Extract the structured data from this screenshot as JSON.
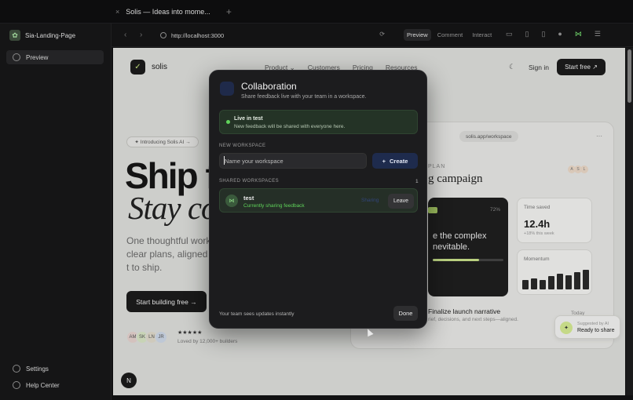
{
  "window": {
    "tab_title": "Solis — Ideas into mome...",
    "tab_close": "×",
    "new_tab": "+"
  },
  "sidebar": {
    "project": "Sia-Landing-Page",
    "items": [
      {
        "label": "Preview",
        "icon": "preview-icon"
      }
    ],
    "bottom": [
      {
        "label": "Settings",
        "icon": "gear-icon"
      },
      {
        "label": "Help Center",
        "icon": "help-icon"
      }
    ]
  },
  "toolbar": {
    "back": "‹",
    "forward": "›",
    "url": "http://localhost:3000",
    "modes": [
      "Preview",
      "Comment",
      "Interact"
    ],
    "active_mode": "Preview"
  },
  "page": {
    "brand": "solis",
    "menu": [
      "Product ⌄",
      "Customers",
      "Pricing",
      "Resources"
    ],
    "sign_in": "Sign in",
    "start_free": "Start free ↗",
    "pill": "✦ Introducing Solis AI →",
    "hero1": "Ship f",
    "hero2": "Stay co",
    "lead": "One thoughtful work clear plans, aligned t to ship.",
    "cta": "Start building free →",
    "avatars": [
      "AM",
      "SK",
      "LN",
      "JR"
    ],
    "stars": "★★★★★",
    "loved": "Loved by 12,000+ builders",
    "fab": "N",
    "card": {
      "url": "solis.app/workspace",
      "dots": "···",
      "plan": "PLAN",
      "title": "g campaign",
      "badges": [
        "A",
        "S",
        "L"
      ],
      "dark_pct": "72%",
      "dark_text": "e the complex nevitable.",
      "progress": 0.65,
      "time_saved_label": "Time saved",
      "time_saved_value": "12.4h",
      "time_saved_sub": "+18% this week",
      "momentum_label": "Momentum",
      "momentum": [
        0.45,
        0.55,
        0.45,
        0.65,
        0.75,
        0.7,
        0.85,
        0.95
      ],
      "finalize": "Finalize launch narrative",
      "finalize_sub": "rief, decisions, and next steps—aligned.",
      "today": "Today"
    },
    "toast": {
      "top": "Suggested by AI",
      "main": "Ready to share"
    }
  },
  "modal": {
    "title": "Collaboration",
    "subtitle": "Share feedback live with your team in a workspace.",
    "live_title": "Live in test",
    "live_desc": "New feedback will be shared with everyone here.",
    "new_ws_label": "NEW WORKSPACE",
    "name_placeholder": "Name your workspace",
    "create": "Create",
    "shared_label": "SHARED WORKSPACES",
    "shared_count": "1",
    "workspaces": [
      {
        "name": "test",
        "status": "Currently sharing feedback",
        "ghost": "Sharing",
        "action": "Leave"
      }
    ],
    "footer": "Your team sees updates instantly",
    "done": "Done"
  },
  "colors": {
    "accent_green": "#5fd35a",
    "create_bg": "#1e2b4d",
    "page_bg": "#dfe0dd"
  }
}
